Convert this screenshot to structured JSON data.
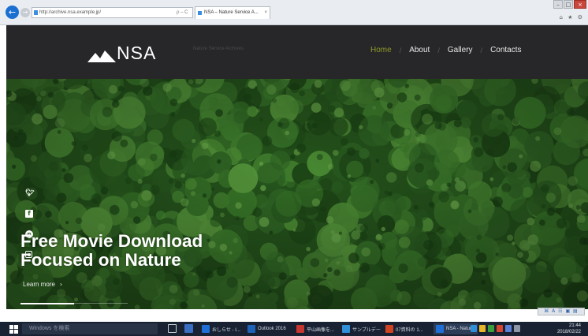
{
  "browser": {
    "address_url": "http://archive.nsa.example.jp/",
    "address_tools": "ρ – C",
    "tab_title": "NSA – Nature Service A...",
    "tab_close": "×",
    "back_glyph": "←",
    "forward_glyph": "→",
    "window_buttons": {
      "minimize": "–",
      "maximize": "□",
      "close": "×"
    },
    "toolbar_icons": "⌂ ★ ⚙"
  },
  "site": {
    "logo_text": "NSA",
    "tagline": "Nature Service Archives",
    "nav": [
      {
        "label": "Home",
        "active": true
      },
      {
        "label": "About",
        "active": false
      },
      {
        "label": "Gallery",
        "active": false
      },
      {
        "label": "Contacts",
        "active": false
      }
    ],
    "nav_separator": "/",
    "colors": {
      "header_bg": "#272628",
      "nav_active": "#8f9a2a",
      "hero_forest": "#2f6424"
    }
  },
  "hero": {
    "title_line1": "Free Movie Download",
    "title_line2": "Focused on Nature",
    "learn_more": "Learn more",
    "learn_more_arrow": "›",
    "slider_progress": 0.5,
    "social": [
      {
        "name": "twitter-icon",
        "glyph": "❧"
      },
      {
        "name": "facebook-icon",
        "glyph": "f"
      },
      {
        "name": "pinterest-icon",
        "glyph": "p"
      },
      {
        "name": "instagram-icon",
        "glyph": ""
      }
    ]
  },
  "taskbar": {
    "search_placeholder": "Windows を検索",
    "items": [
      {
        "label": "おしらせ - I...",
        "color": "#1f6fd6"
      },
      {
        "label": "Outlook 2016",
        "color": "#1f63b8"
      },
      {
        "label": "平山画像を...",
        "color": "#c7372f"
      },
      {
        "label": "サンプルデー",
        "color": "#2f8fd9"
      },
      {
        "label": "07資料の 1...",
        "color": "#d04423"
      },
      {
        "label": "NSA - Natur...",
        "color": "#1f6fd6"
      }
    ],
    "tray_colors": [
      "#2f8fd9",
      "#e7b527",
      "#3a9f3a",
      "#d8452e",
      "#5b7fd6",
      "#8e96a6"
    ],
    "clock_time": "21:44",
    "clock_date": "2018/02/22",
    "tray_mini": "⌘ A ☷ ▣ ▤"
  }
}
